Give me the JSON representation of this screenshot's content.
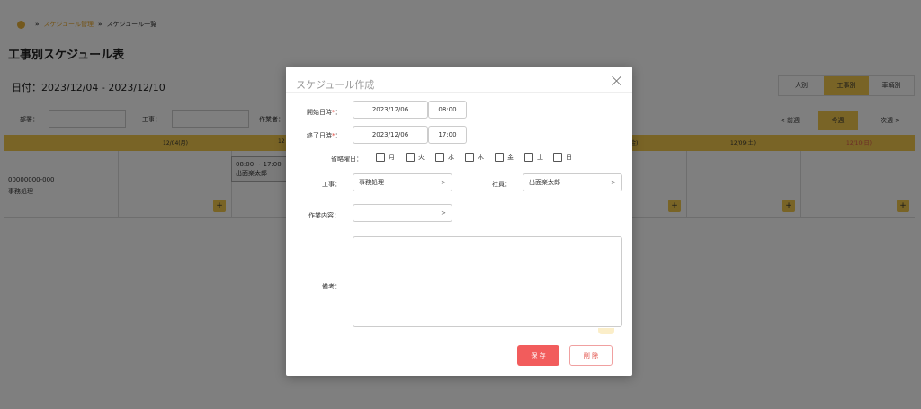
{
  "breadcrumb": {
    "link": "スケジュール管理",
    "separator": "»",
    "current": "スケジュール一覧"
  },
  "page": {
    "title": "工事別スケジュール表",
    "date_range": "日付：2023/12/04 - 2023/12/10"
  },
  "view_toggle": [
    "人別",
    "工事別",
    "車輌別"
  ],
  "filters": {
    "dept_label": "部署：",
    "work_label": "工事：",
    "worker_label": "作業者："
  },
  "week_nav": {
    "prev": "< 前週",
    "current": "今週",
    "next": "次週 >"
  },
  "calendar": {
    "headers": [
      "12/04(月)",
      "12",
      "金)",
      "12/09(土)",
      "12/10(日)"
    ],
    "row_code": "00000000-000",
    "row_name": "事務処理",
    "event_time": "08:00 ~ 17:00",
    "event_person": "出面楽太郎",
    "add_symbol": "+"
  },
  "modal": {
    "title": "スケジュール作成",
    "start_label": "開始日時",
    "end_label": "終了日時",
    "required_mark": "*",
    "colon": "：",
    "start_date": "2023/12/06",
    "start_time": "08:00",
    "end_date": "2023/12/06",
    "end_time": "17:00",
    "omit_days_label": "省略曜日：",
    "days": [
      "月",
      "火",
      "水",
      "木",
      "金",
      "土",
      "日"
    ],
    "work_label": "工事：",
    "work_value": "事務処理",
    "employee_label": "社員：",
    "employee_value": "出面楽太郎",
    "task_label": "作業内容：",
    "task_value": "",
    "notes_label": "備考：",
    "chevron": ">",
    "save_label": "保 存",
    "delete_label": "削 除"
  },
  "colors": {
    "accent": "#f2c94c",
    "danger": "#f25c5c",
    "overlay": "rgba(0,0,0,0.5)"
  }
}
